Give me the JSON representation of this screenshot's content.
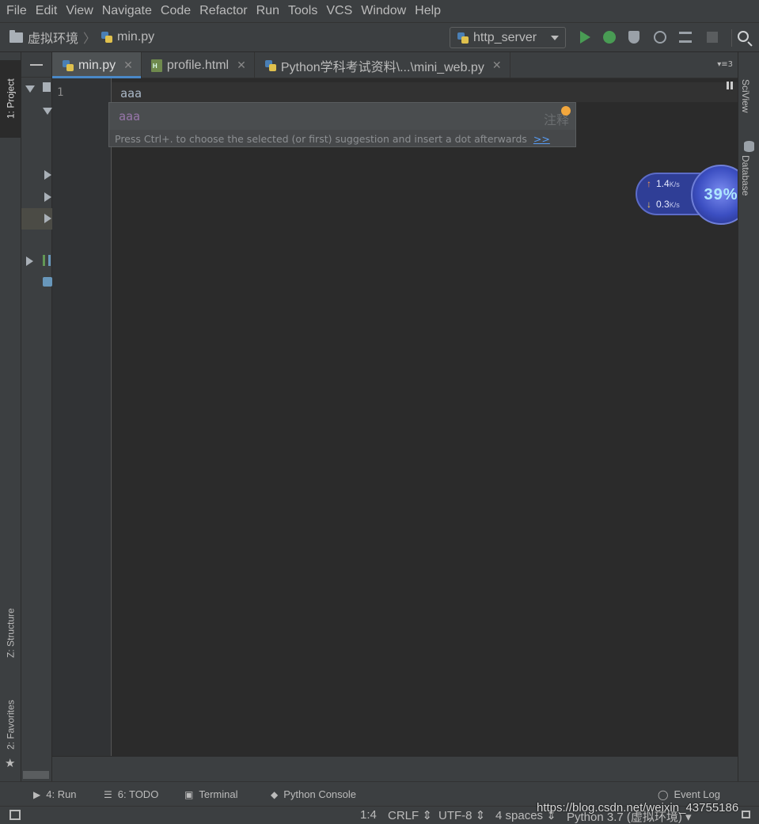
{
  "menu": [
    "File",
    "Edit",
    "View",
    "Navigate",
    "Code",
    "Refactor",
    "Run",
    "Tools",
    "VCS",
    "Window",
    "Help"
  ],
  "breadcrumb": {
    "project": "虚拟环境",
    "file": "min.py"
  },
  "run_config": "http_server",
  "left_tabs": {
    "project": "1: Project",
    "structure": "Z: Structure",
    "favorites": "2: Favorites"
  },
  "right_tabs": {
    "sciview": "SciView",
    "database": "Database"
  },
  "tabs": [
    {
      "label": "min.py",
      "active": true
    },
    {
      "label": "profile.html",
      "active": false
    },
    {
      "label": "Python学科考试资料\\...\\mini_web.py",
      "active": false
    }
  ],
  "tab_overflow": "3",
  "editor": {
    "line_number": "1",
    "code": "aaa"
  },
  "completion": {
    "item": "aaa",
    "tail": "注释",
    "hint": "Press Ctrl+. to choose the selected (or first) suggestion and insert a dot afterwards",
    "hint_link": ">>"
  },
  "network_widget": {
    "up": "1.4",
    "down": "0.3",
    "unit": "K/s",
    "percent": "39%"
  },
  "bottom_tabs": {
    "run": "4: Run",
    "todo": "6: TODO",
    "terminal": "Terminal",
    "console": "Python Console",
    "event_log": "Event Log"
  },
  "status": {
    "position": "1:4",
    "line_sep": "CRLF",
    "encoding": "UTF-8",
    "indent": "4 spaces",
    "interpreter": "Python 3.7 (虚拟环境)"
  },
  "watermark": "https://blog.csdn.net/weixin_43755186",
  "colors": {
    "accent": "#4a88c7",
    "run_green": "#499c54",
    "editor_bg": "#2b2b2b",
    "completion_text": "#9876aa",
    "link": "#589df6"
  }
}
